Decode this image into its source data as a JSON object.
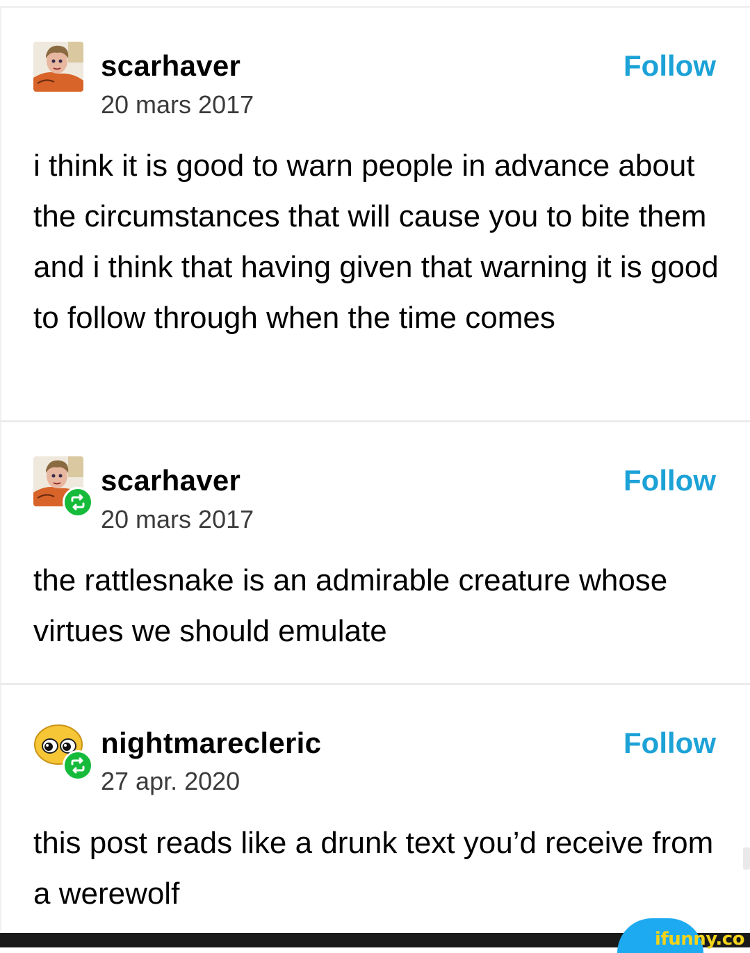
{
  "posts": [
    {
      "username": "scarhaver",
      "date": "20 mars 2017",
      "follow_label": "Follow",
      "body": "i think it is good to warn people in advance about the circumstances that will cause you to bite them and i think that having given that warning it is good to follow through when the time comes",
      "avatar_icon": "user-avatar-drawing",
      "reblog": false
    },
    {
      "username": "scarhaver",
      "date": "20 mars 2017",
      "follow_label": "Follow",
      "body": "the rattlesnake is an admirable creature whose virtues we should emulate",
      "avatar_icon": "user-avatar-drawing",
      "reblog": true
    },
    {
      "username": "nightmarecleric",
      "date": "27 apr. 2020",
      "follow_label": "Follow",
      "body": "this post reads like a drunk text you’d receive from a werewolf",
      "avatar_icon": "emoji-face-avatar",
      "reblog": true
    }
  ],
  "watermark": "ifunny.co",
  "colors": {
    "follow": "#1ca2d6",
    "reblog_badge": "#16bb3b",
    "divider": "#ebebeb"
  }
}
